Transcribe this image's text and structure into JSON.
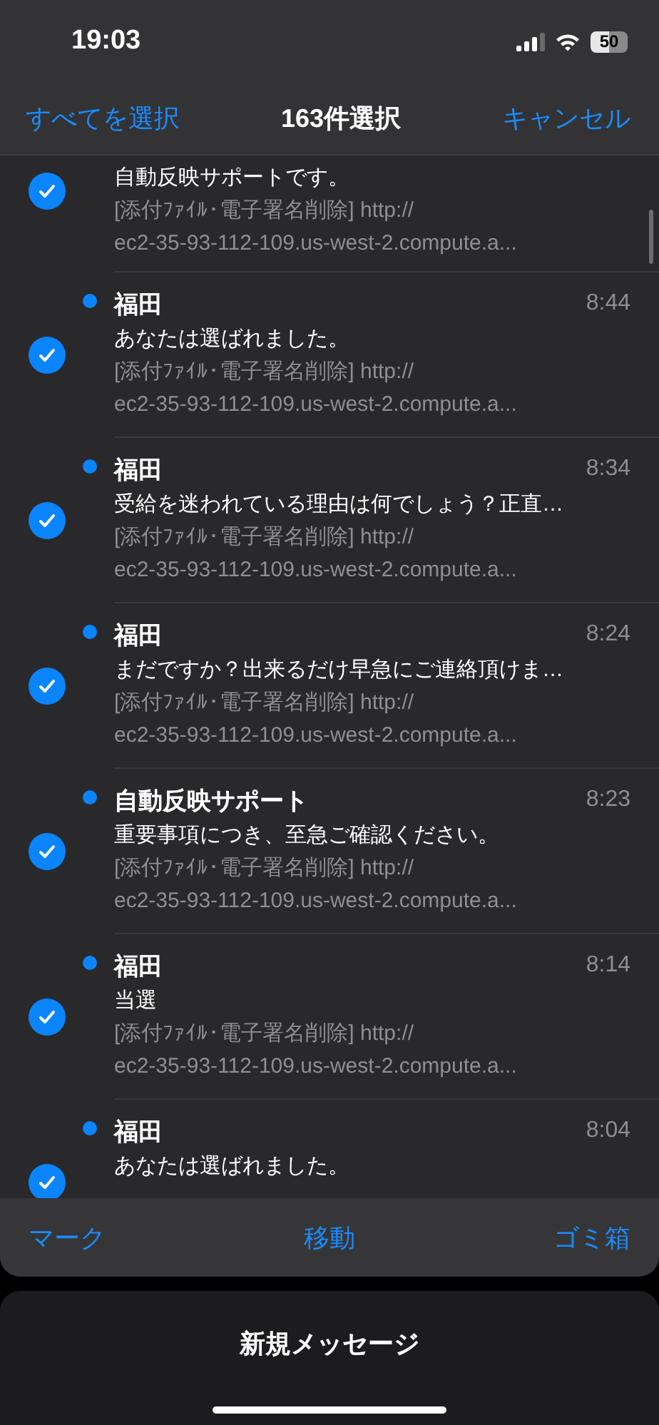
{
  "status_bar": {
    "time": "19:03",
    "battery": "50"
  },
  "nav": {
    "left": "すべてを選択",
    "title": "163件選択",
    "right": "キャンセル"
  },
  "messages": [
    {
      "kind": "partial",
      "selected": true,
      "subject": "自動反映サポートです。",
      "preview": [
        "[添付ﾌｧｲﾙ･電子署名削除] http://",
        "ec2-35-93-112-109.us-west-2.compute.a..."
      ]
    },
    {
      "kind": "full",
      "selected": true,
      "unread": true,
      "sender": "福田",
      "time": "8:44",
      "subject": "あなたは選ばれました。",
      "preview": [
        "[添付ﾌｧｲﾙ･電子署名削除] http://",
        "ec2-35-93-112-109.us-west-2.compute.a..."
      ]
    },
    {
      "kind": "full",
      "selected": true,
      "unread": true,
      "sender": "福田",
      "time": "8:34",
      "subject": "受給を迷われている理由は何でしょう？正直…",
      "preview": [
        "[添付ﾌｧｲﾙ･電子署名削除] http://",
        "ec2-35-93-112-109.us-west-2.compute.a..."
      ]
    },
    {
      "kind": "full",
      "selected": true,
      "unread": true,
      "sender": "福田",
      "time": "8:24",
      "subject": "まだですか？出来るだけ早急にご連絡頂けま…",
      "preview": [
        "[添付ﾌｧｲﾙ･電子署名削除] http://",
        "ec2-35-93-112-109.us-west-2.compute.a..."
      ]
    },
    {
      "kind": "full",
      "selected": true,
      "unread": true,
      "sender": "自動反映サポート",
      "time": "8:23",
      "subject": "重要事項につき、至急ご確認ください。",
      "preview": [
        "[添付ﾌｧｲﾙ･電子署名削除] http://",
        "ec2-35-93-112-109.us-west-2.compute.a..."
      ]
    },
    {
      "kind": "full",
      "selected": true,
      "unread": true,
      "sender": "福田",
      "time": "8:14",
      "subject": "当選",
      "preview": [
        "[添付ﾌｧｲﾙ･電子署名削除] http://",
        "ec2-35-93-112-109.us-west-2.compute.a..."
      ]
    },
    {
      "kind": "full",
      "selected": true,
      "unread": true,
      "sender": "福田",
      "time": "8:04",
      "subject": "あなたは選ばれました。"
    }
  ],
  "toolbar": [
    "マーク",
    "移動",
    "ゴミ箱"
  ],
  "compose": {
    "label": "新規メッセージ"
  }
}
